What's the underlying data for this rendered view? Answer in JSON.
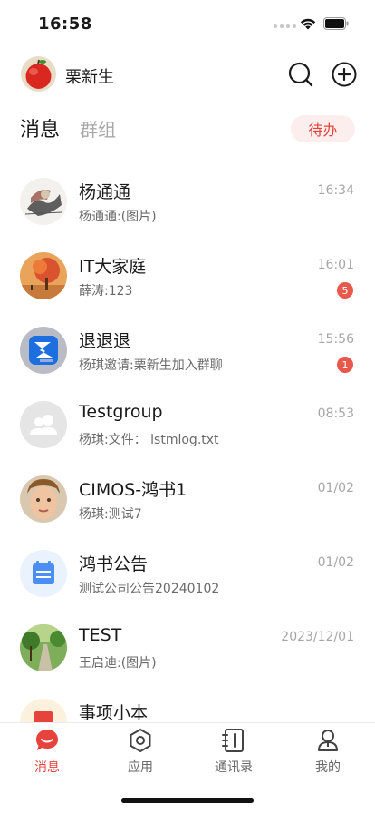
{
  "status_bar": {
    "time": "16:58"
  },
  "header": {
    "user_name": "栗新生"
  },
  "tabs": {
    "messages": "消息",
    "groups": "群组",
    "todo": "待办"
  },
  "colors": {
    "accent": "#e5433b",
    "badge": "#e8584d",
    "todo_bg": "#fdeeee"
  },
  "conversations": [
    {
      "title": "杨通通",
      "preview": "杨通通:(图片)",
      "time": "16:34",
      "badge": "",
      "avatar": "sketch-avatar"
    },
    {
      "title": "IT大家庭",
      "preview": "薛涛:123",
      "time": "16:01",
      "badge": "5",
      "avatar": "autumn-tree-avatar"
    },
    {
      "title": "退退退",
      "preview": "杨琪邀请:栗新生加入群聊",
      "time": "15:56",
      "badge": "1",
      "avatar": "app-logo-avatar"
    },
    {
      "title": "Testgroup",
      "preview": "杨琪:文件： lstmlog.txt",
      "time": "08:53",
      "badge": "",
      "avatar": "group-default-avatar"
    },
    {
      "title": "CIMOS-鸿书1",
      "preview": "杨琪:测试7",
      "time": "01/02",
      "badge": "",
      "avatar": "child-photo-avatar"
    },
    {
      "title": "鸿书公告",
      "preview": "测试公司公告20240102",
      "time": "01/02",
      "badge": "",
      "avatar": "calendar-avatar"
    },
    {
      "title": "TEST",
      "preview": "王启迪:(图片)",
      "time": "2023/12/01",
      "badge": "",
      "avatar": "park-path-avatar"
    },
    {
      "title": "事项小本",
      "preview": "",
      "time": "",
      "badge": "",
      "avatar": "notebook-avatar"
    }
  ],
  "bottom_nav": [
    {
      "label": "消息",
      "icon": "message-icon",
      "active": true
    },
    {
      "label": "应用",
      "icon": "apps-icon",
      "active": false
    },
    {
      "label": "通讯录",
      "icon": "contacts-icon",
      "active": false
    },
    {
      "label": "我的",
      "icon": "profile-icon",
      "active": false
    }
  ]
}
